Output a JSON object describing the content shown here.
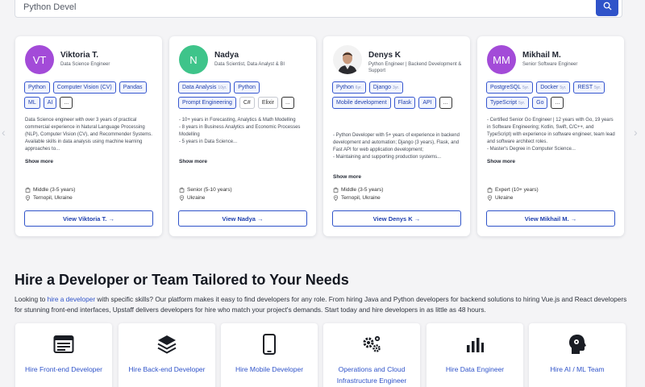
{
  "search": {
    "value": "Python Devel"
  },
  "cards": [
    {
      "initials": "VT",
      "avatar_color": "#a34bd8",
      "name": "Viktoria T.",
      "title": "Data Science Engineer",
      "tags": [
        "Python",
        "Computer Vision (CV)",
        "Pandas",
        "ML",
        "AI",
        "..."
      ],
      "description": "Data Science engineer with over 3 years of practical commercial experience in Natural Language Processing (NLP), Computer Vision (CV), and Recommender Systems. Available skills in data analysis using machine learning approaches to...",
      "show_more": "Show more",
      "level": "Middle (3-5 years)",
      "location": "Ternopil, Ukraine",
      "button": "View Viktoria T. →"
    },
    {
      "initials": "N",
      "avatar_color": "#3ec48a",
      "name": "Nadya",
      "title": "Data Scientist, Data Analyst & BI",
      "tags": [
        "Data Analysis",
        "10yr.",
        "Python",
        "Prompt Engineering",
        "C#",
        "Elixir",
        "..."
      ],
      "description": "- 10+ years in Forecasting, Analytics & Math Modelling\n- 8 years in Business Analytics and Economic Processes Modelling\n- 5 years in Data Science...",
      "show_more": "Show more",
      "level": "Senior (5-10 years)",
      "location": "Ukraine",
      "button": "View Nadya →"
    },
    {
      "initials": "",
      "avatar_color": "#ffffff",
      "name": "Denys K",
      "title": "Python Engineer | Backend Development & Support",
      "tags": [
        "Python",
        "6yr.",
        "Django",
        "3yr.",
        "Mobile development",
        "Flask",
        "API",
        "..."
      ],
      "description": "- Python Developer with 5+ years of experience in backend development and automation; Django (3 years), Flask, and Fast API for web application development;\n- Maintaining and supporting production systems...",
      "show_more": "Show more",
      "level": "Middle (3-5 years)",
      "location": "Ternopil, Ukraine",
      "button": "View Denys K →"
    },
    {
      "initials": "MM",
      "avatar_color": "#a34bd8",
      "name": "Mikhail M.",
      "title": "Senior Software Engineer",
      "tags": [
        "PostgreSQL",
        "5yr.",
        "Docker",
        "5yr.",
        "REST",
        "5yr.",
        "TypeScript",
        "5yr.",
        "Go",
        "..."
      ],
      "description": "- Certified Senior Go Engineer | 12 years with Go, 19 years in Software Engineering; Kotlin, Swift, C/C++, and TypeScript) with experience in software engineer, team lead and software architect roles.\n- Master's Degree in Computer Science...",
      "show_more": "Show more",
      "level": "Expert (10+ years)",
      "location": "Ukraine",
      "button": "View Mikhail M. →"
    }
  ],
  "section": {
    "title": "Hire a Developer or Team Tailored to Your Needs",
    "text_before": "Looking to ",
    "link": "hire a developer",
    "text_after": " with specific skills? Our platform makes it easy to find developers for any role. From hiring Java and Python developers for backend solutions to hiring Vue.js and React developers for stunning front-end interfaces, Upstaff delivers developers for hire who match your project's demands. Start today and hire developers in as little as 48 hours."
  },
  "services": [
    {
      "icon": "browser-window-icon",
      "label": "Hire Front-end Developer"
    },
    {
      "icon": "layers-stack-icon",
      "label": "Hire Back-end Developer"
    },
    {
      "icon": "smartphone-icon",
      "label": "Hire Mobile Developer"
    },
    {
      "icon": "gears-icon",
      "label": "Operations and Cloud Infrastructure Engineer"
    },
    {
      "icon": "bar-chart-icon",
      "label": "Hire Data Engineer"
    },
    {
      "icon": "ai-head-icon",
      "label": "Hire AI / ML Team"
    }
  ],
  "colors": {
    "accent": "#2f53c9",
    "tag_bg": "#f1f4fd",
    "page_bg": "#f4f4f6"
  }
}
